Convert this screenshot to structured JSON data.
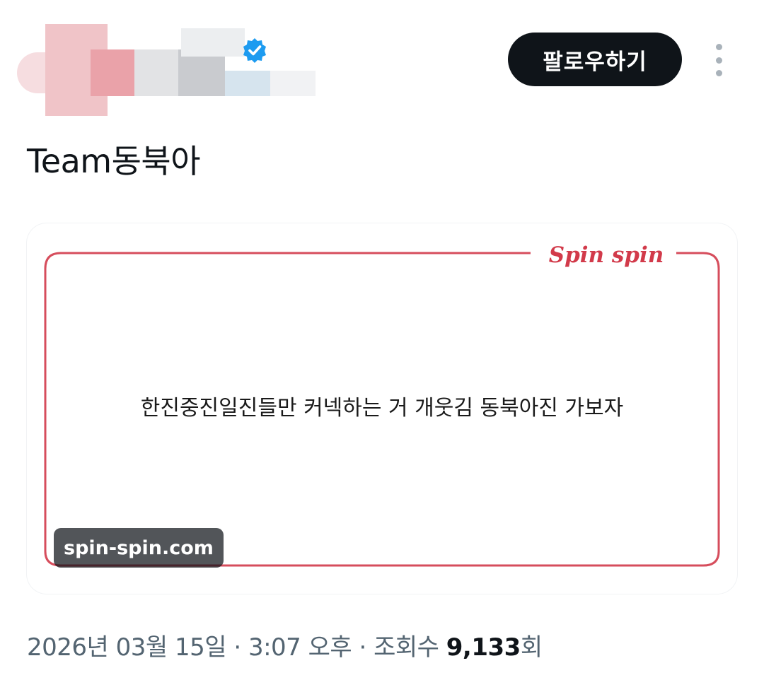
{
  "header": {
    "follow_label": "팔로우하기"
  },
  "tweet": {
    "text": "Team동북아"
  },
  "media": {
    "brand": "Spin spin",
    "message": "한진중진일진들만 커넥하는 거 개웃김 동북아진 가보자",
    "link_label": "spin-spin.com",
    "accent_color": "#d23a4a"
  },
  "meta": {
    "date": "2026년 03월 15일",
    "sep1": " · ",
    "time": "3:07 오후",
    "sep2": " · ",
    "views_prefix": "조회수 ",
    "views_count": "9,133",
    "views_suffix": "회"
  },
  "icons": {
    "verified": "verified-badge-icon",
    "more": "more-vertical-icon"
  }
}
